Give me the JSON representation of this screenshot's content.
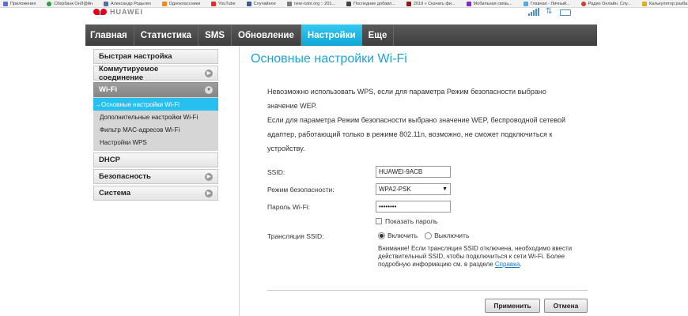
{
  "bookmarks": [
    {
      "label": "Приложения",
      "color": "#5b6fd6",
      "round": false
    },
    {
      "label": "Сбербанк ОнЛ@йн",
      "color": "#2e9d3c",
      "round": true
    },
    {
      "label": "Александр Родыгин",
      "color": "#4f6fa8",
      "round": false
    },
    {
      "label": "Одноклассники",
      "color": "#f28a1e",
      "round": false
    },
    {
      "label": "YouTube",
      "color": "#e52d27",
      "round": false
    },
    {
      "label": "Случайное",
      "color": "#3b5998",
      "round": false
    },
    {
      "label": "new-rutor.org :: 201...",
      "color": "#7a7a7a",
      "round": false
    },
    {
      "label": "Последние добавл...",
      "color": "#444444",
      "round": false
    },
    {
      "label": "2019 » Скачать фи...",
      "color": "#8b1a1a",
      "round": false
    },
    {
      "label": "Мобильная связь...",
      "color": "#7b2fbe",
      "round": false
    },
    {
      "label": "Главная - Личный...",
      "color": "#56a9e0",
      "round": false
    },
    {
      "label": "Радио Онлайн. Слу...",
      "color": "#d33c2d",
      "round": true
    },
    {
      "label": "Калькулятор разба...",
      "color": "#e0b020",
      "round": false
    }
  ],
  "logo_word": "HUAWEI",
  "nav": [
    "Главная",
    "Статистика",
    "SMS",
    "Обновление",
    "Настройки",
    "Еще"
  ],
  "nav_active": "Настройки",
  "sidebar": {
    "quick": "Быстрая настройка",
    "dialup": "Коммутируемое соединение",
    "wifi": "Wi-Fi",
    "wifi_items": [
      "→Основные настройки Wi-Fi",
      "Дополнительные настройки Wi-Fi",
      "Фильтр MAC-адресов Wi-Fi",
      "Настройки WPS"
    ],
    "dhcp": "DHCP",
    "security": "Безопасность",
    "system": "Система"
  },
  "page_title": "Основные настройки Wi-Fi",
  "info": {
    "line1": "Невозможно использовать WPS, если для параметра Режим безопасности выбрано",
    "line2": "значение WEP.",
    "line3": "Если для параметра Режим безопасности выбрано значение WEP, беспроводной сетевой",
    "line4": "адаптер, работающий только в режиме 802.11n, возможно, не сможет подключиться к",
    "line5": "устройству."
  },
  "form": {
    "ssid_label": "SSID:",
    "ssid_value": "HUAWEI-9ACB",
    "security_label": "Режим безопасности:",
    "security_value": "WPA2-PSK",
    "password_label": "Пароль Wi-Fi:",
    "password_value": "••••••••",
    "show_password": "Показать пароль",
    "broadcast_label": "Трансляция SSID:",
    "enable": "Включить",
    "disable": "Выключить",
    "warning_text": "Внимание! Если трансляция SSID отключена, необходимо ввести действительный SSID, чтобы подключиться к сети Wi-Fi. Более подробную информацию см. в разделе",
    "warning_link": "Справка",
    "warning_end": "."
  },
  "buttons": {
    "apply": "Применить",
    "cancel": "Отмена"
  },
  "colors": {
    "accent": "#1ba3d6",
    "nav_active": "#27bff0",
    "brand": "#e0001b"
  }
}
